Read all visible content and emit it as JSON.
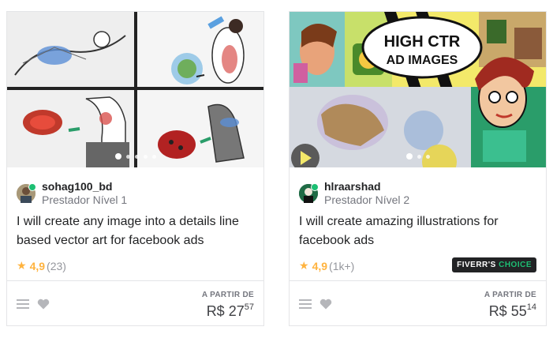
{
  "gigs": [
    {
      "seller_name": "sohag100_bd",
      "seller_level": "Prestador Nível 1",
      "title": "I will create any image into a details line based vector art for facebook ads",
      "rating": "4,9",
      "rating_count": "(23)",
      "price_label": "A PARTIR DE",
      "price_currency": "R$",
      "price_whole": "27",
      "price_cents": "57"
    },
    {
      "seller_name": "hlraarshad",
      "seller_level": "Prestador Nível 2",
      "title": "I will create amazing illustrations for facebook ads",
      "rating": "4,9",
      "rating_count": "(1k+)",
      "badge_main": "FIVERR'S",
      "badge_accent": "CHOICE",
      "price_label": "A PARTIR DE",
      "price_currency": "R$",
      "price_whole": "55",
      "price_cents": "14",
      "thumb_text": "HIGH CTR AD IMAGES"
    }
  ],
  "colors": {
    "star": "#ffb33e",
    "online": "#1dbf73",
    "badge_bg": "#222325"
  },
  "icons": {
    "menu": "menu-icon",
    "heart": "heart-icon",
    "star": "star-icon",
    "play": "play-icon"
  }
}
